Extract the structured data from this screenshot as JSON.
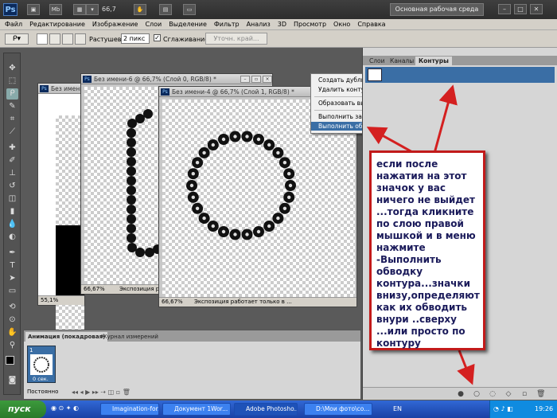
{
  "app": {
    "logo": "Ps",
    "zoom": "66,7",
    "workspace": "Основная рабочая среда",
    "window_controls": [
      "–",
      "□",
      "✕"
    ]
  },
  "menu": [
    "Файл",
    "Редактирование",
    "Изображение",
    "Слои",
    "Выделение",
    "Фильтр",
    "Анализ",
    "3D",
    "Просмотр",
    "Окно",
    "Справка"
  ],
  "options": {
    "feather_label": "Растушевка:",
    "feather_value": "2 пикс",
    "antialias_label": "Сглаживание",
    "refine_button": "Уточн. край..."
  },
  "docs": {
    "doc1": {
      "title": "Без имени",
      "zoom": "55,1%"
    },
    "doc2": {
      "title": "Без имени-6 @ 66,7% (Слой 0, RGB/8) *",
      "zoom": "66,67%",
      "status": "Экспозиция работает только в..."
    },
    "doc3": {
      "title": "Без имени-4 @ 66,7% (Слой 1, RGB/8) *",
      "zoom": "66,67%",
      "status": "Экспозиция работает только в ..."
    }
  },
  "context_menu": [
    "Создать дубликат контура...",
    "Удалить контур",
    "Образовать выделенную область...",
    "Выполнить заливку контура...",
    "Выполнить обводку контура..."
  ],
  "panel": {
    "tabs": [
      "Слои",
      "Каналы",
      "Контуры"
    ],
    "active_tab": "Контуры"
  },
  "annotation": "если после нажатия на этот значок у вас ничего не выйдет ...тогда кликните по слою правой мышкой и в меню нажмите -Выполнить обводку контура...значки внизу,определяют как их обводить внури ..сверху ...или просто по контуру",
  "animation": {
    "tabs": [
      "Анимация (покадровая)",
      "Журнал измерений"
    ],
    "frame_number": "1",
    "frame_delay": "0 сек.",
    "loop": "Постоянно"
  },
  "taskbar": {
    "start": "пуск",
    "tasks": [
      "Imagination-for...",
      "Документ 1Wor...",
      "Adobe Photosho...",
      "D:\\Мои фото\\со..."
    ],
    "lang": "EN",
    "time": "19:26"
  },
  "colors": {
    "annotation_border": "#c21a1a",
    "arrow": "#d42020",
    "selection": "#3a6ea5"
  }
}
